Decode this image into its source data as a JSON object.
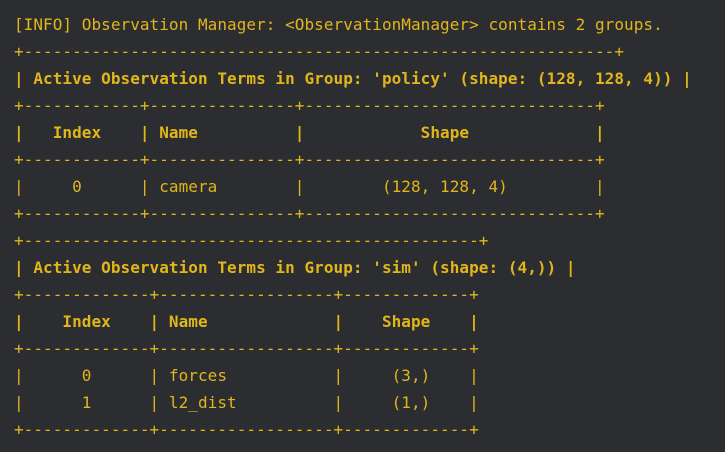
{
  "theme": {
    "background": "#2b2d30",
    "text_color": "#e1b61b"
  },
  "lines": [
    "[INFO] Observation Manager: <ObservationManager> contains 2 groups.",
    "+-------------------------------------------------------------+",
    "| Active Observation Terms in Group: 'policy' (shape: (128, 128, 4)) |",
    "+------------+---------------+------------------------------+",
    "|   Index    | Name          |            Shape             |",
    "+------------+---------------+------------------------------+",
    "|     0      | camera        |        (128, 128, 4)         |",
    "+------------+---------------+------------------------------+",
    "+-----------------------------------------------+",
    "| Active Observation Terms in Group: 'sim' (shape: (4,)) |",
    "+-------------+------------------+-------------+",
    "|    Index    | Name             |    Shape    |",
    "+-------------+------------------+-------------+",
    "|      0      | forces           |     (3,)    |",
    "|      1      | l2_dist          |     (1,)    |",
    "+-------------+------------------+-------------+"
  ]
}
